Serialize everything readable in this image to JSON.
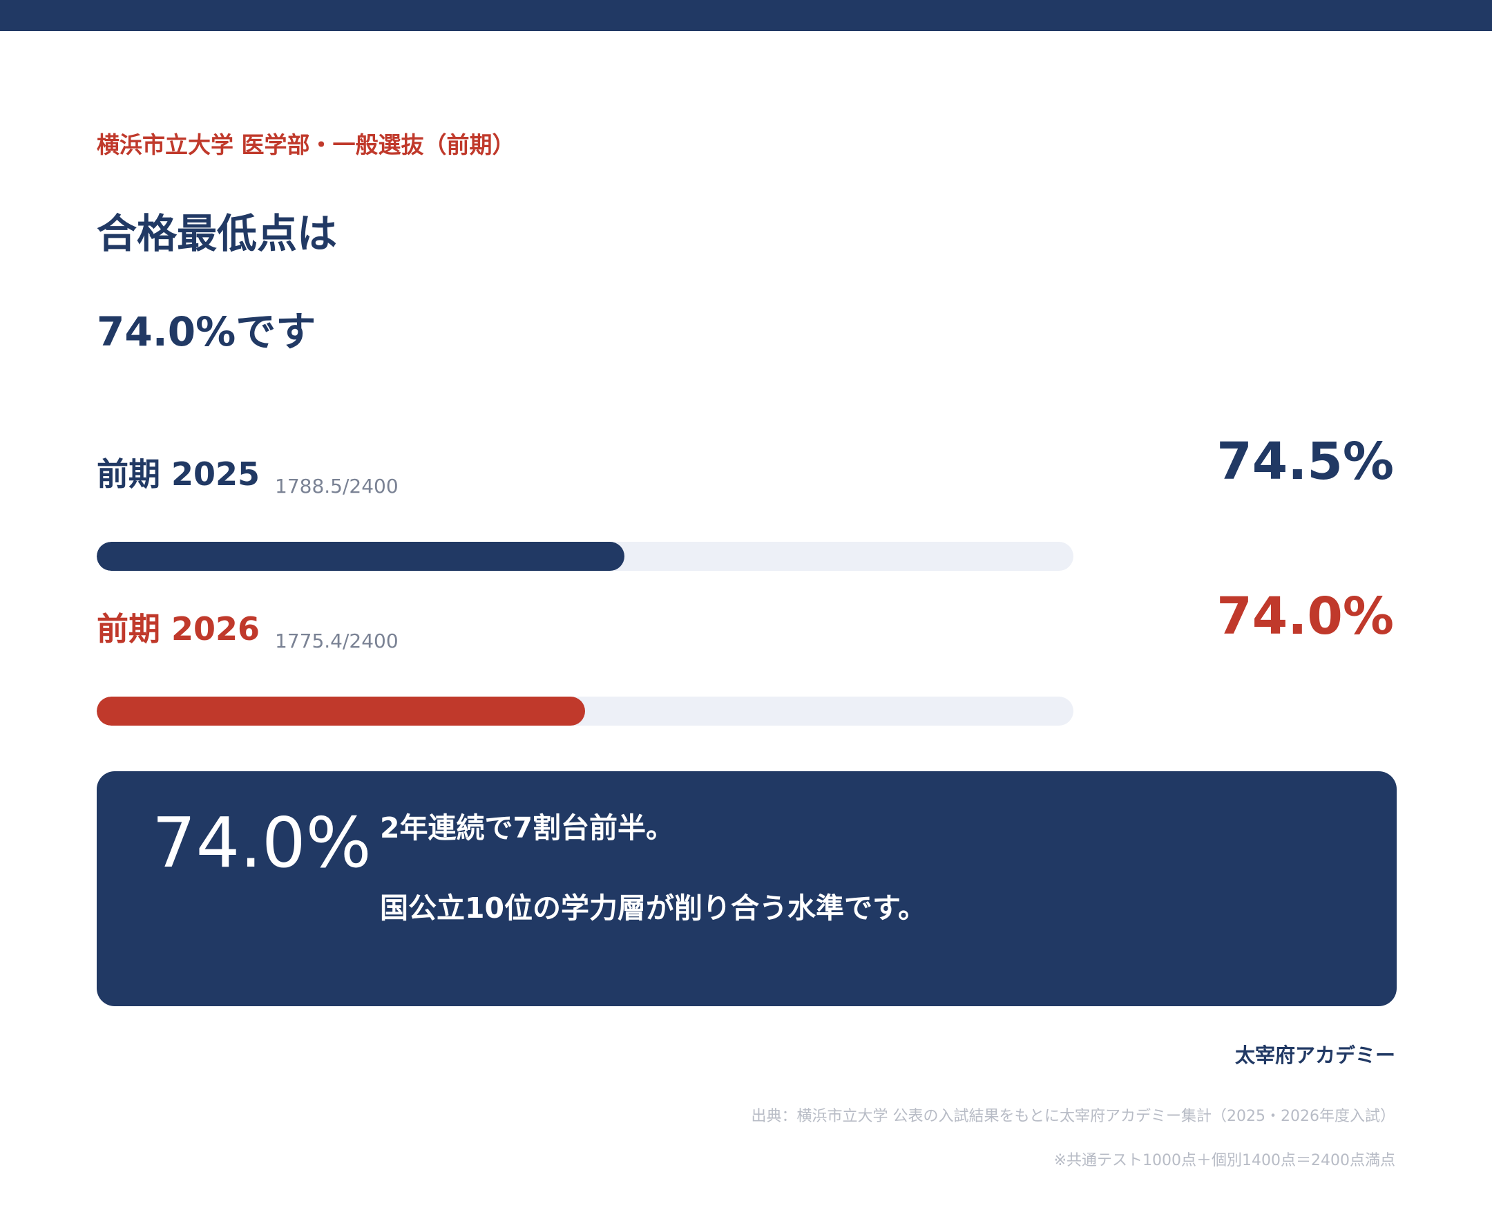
{
  "subtitle": "横浜市立大学 医学部・一般選抜（前期）",
  "headline": {
    "line1": "合格最低点は",
    "line2": "74.0%です"
  },
  "chart_data": {
    "type": "bar",
    "orientation": "horizontal",
    "max_score": 2400,
    "categories": [
      "前期 2025",
      "前期 2026"
    ],
    "series": [
      {
        "label": "前期 2025",
        "score_text": "1788.5/2400",
        "score": 1788.5,
        "percent_text": "74.5%",
        "percent": 74.5,
        "bar_fill_fraction": 0.54,
        "color": "#213964"
      },
      {
        "label": "前期 2026",
        "score_text": "1775.4/2400",
        "score": 1775.4,
        "percent_text": "74.0%",
        "percent": 74.0,
        "bar_fill_fraction": 0.5,
        "color": "#c0392b"
      }
    ]
  },
  "panel": {
    "big_value": "74.0%",
    "line1": "2年連続で7割台前半。",
    "line2": "国公立10位の学力層が削り合う水準です。"
  },
  "brand": "太宰府アカデミー",
  "footnotes": {
    "source": "出典：横浜市立大学 公表の入試結果をもとに太宰府アカデミー集計（2025・2026年度入試）",
    "scoring": "※共通テスト1000点＋個別1400点＝2400点満点"
  },
  "colors": {
    "navy": "#213964",
    "red": "#c0392b",
    "track": "#edf0f7"
  }
}
